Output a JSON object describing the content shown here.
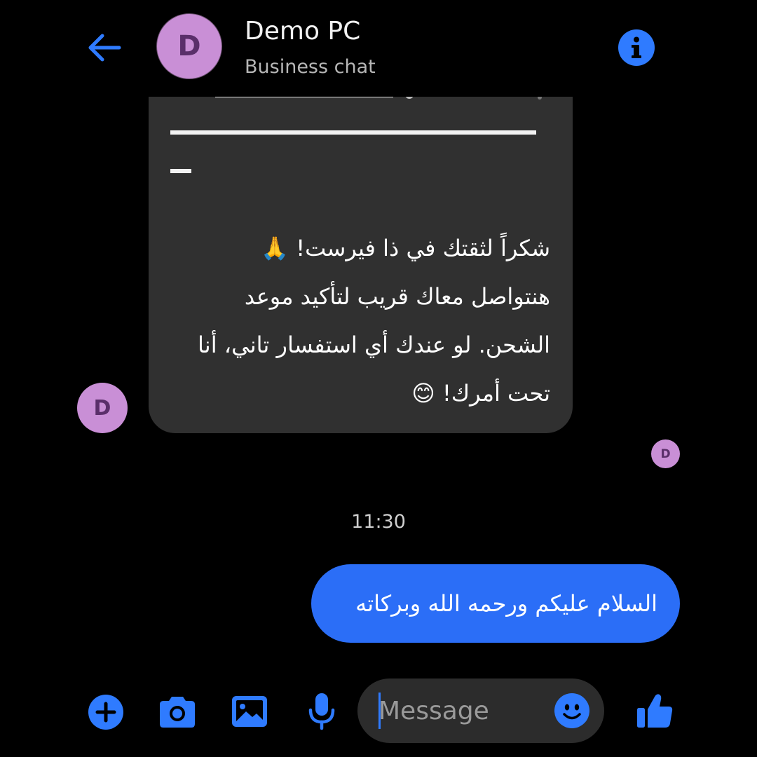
{
  "header": {
    "avatar_initial": "D",
    "title": "Demo PC",
    "subtitle": "Business chat",
    "back_icon": "arrow-left-icon",
    "info_icon": "info-icon"
  },
  "messages": {
    "incoming": {
      "avatar_initial": "D",
      "lines": [
        "شكراً لثقتك في ذا فيرست! 🙏",
        "هنتواصل معاك قريب لتأكيد موعد",
        "الشحن. لو عندك أي استفسار تاني، أنا",
        "تحت أمرك! 😊"
      ]
    },
    "read_receipt_initial": "D",
    "timestamp": "11:30",
    "outgoing": {
      "text": "السلام عليكم ورحمه الله وبركاته"
    }
  },
  "composer": {
    "placeholder": "Message",
    "icons": [
      "plus-icon",
      "camera-icon",
      "image-icon",
      "microphone-icon",
      "emoji-icon",
      "thumbs-up-icon"
    ]
  },
  "colors": {
    "background": "#000000",
    "accent": "#2f7bff",
    "outgoing_bubble": "#2b6ef7",
    "incoming_bubble": "#303030",
    "avatar": "#c98fd6",
    "avatar_text": "#5a2f6a"
  }
}
